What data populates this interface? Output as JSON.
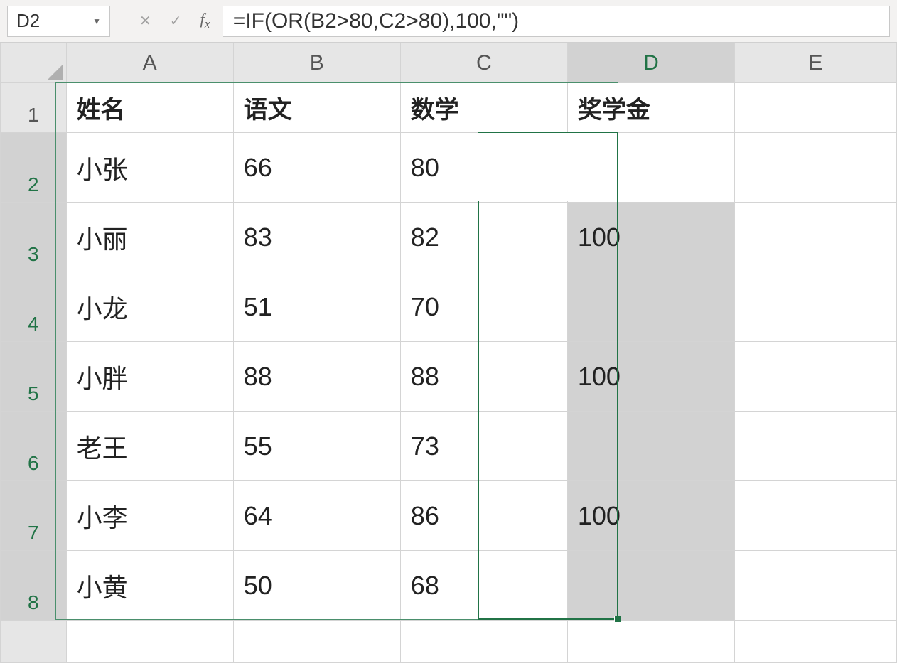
{
  "nameBox": "D2",
  "formula": "=IF(OR(B2>80,C2>80),100,\"\")",
  "columns": [
    "A",
    "B",
    "C",
    "D",
    "E"
  ],
  "rowNums": [
    "1",
    "2",
    "3",
    "4",
    "5",
    "6",
    "7",
    "8"
  ],
  "headers": {
    "A": "姓名",
    "B": "语文",
    "C": "数学",
    "D": "奖学金",
    "E": ""
  },
  "rows": [
    {
      "A": "小张",
      "B": "66",
      "C": "80",
      "D": "",
      "E": ""
    },
    {
      "A": "小丽",
      "B": "83",
      "C": "82",
      "D": "100",
      "E": ""
    },
    {
      "A": "小龙",
      "B": "51",
      "C": "70",
      "D": "",
      "E": ""
    },
    {
      "A": "小胖",
      "B": "88",
      "C": "88",
      "D": "100",
      "E": ""
    },
    {
      "A": "老王",
      "B": "55",
      "C": "73",
      "D": "",
      "E": ""
    },
    {
      "A": "小李",
      "B": "64",
      "C": "86",
      "D": "100",
      "E": ""
    },
    {
      "A": "小黄",
      "B": "50",
      "C": "68",
      "D": "",
      "E": ""
    }
  ],
  "activeColumn": "D",
  "activeCell": "D2",
  "selection": {
    "col": "D",
    "rowStart": 2,
    "rowEnd": 8
  }
}
